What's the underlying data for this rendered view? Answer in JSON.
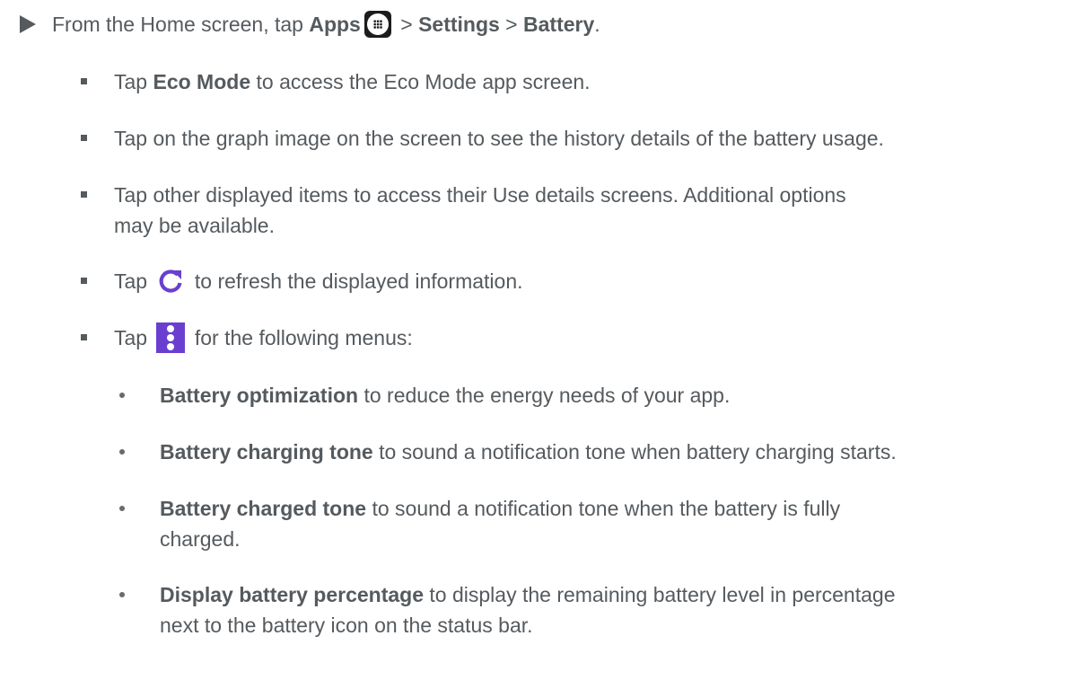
{
  "step": {
    "prefix": "From the Home screen, tap ",
    "apps": "Apps",
    "sep1": " > ",
    "settings": "Settings",
    "sep2": " > ",
    "battery": "Battery",
    "suffix": "."
  },
  "bullets": [
    {
      "pre": "Tap ",
      "bold": "Eco Mode",
      "post": " to access the Eco Mode app screen."
    },
    {
      "text": "Tap on the graph image on the screen to see the history details of the battery usage."
    },
    {
      "line1": "Tap other displayed items to access their Use details screens. Additional options",
      "line2": "may be available."
    },
    {
      "pre": "Tap ",
      "post": " to refresh the displayed information.",
      "icon": "refresh-icon"
    },
    {
      "pre": "Tap ",
      "post": " for the following menus:",
      "icon": "more-vert-icon"
    }
  ],
  "menus": [
    {
      "bold": "Battery optimization",
      "text": " to reduce the energy needs of your app."
    },
    {
      "bold": "Battery charging tone",
      "text": " to sound a notification tone when battery charging starts."
    },
    {
      "bold": "Battery charged tone",
      "text": " to sound a notification tone when the battery is fully",
      "line2": "charged."
    },
    {
      "bold": "Display battery percentage",
      "text": " to display the remaining battery level in percentage",
      "line2": "next to the battery icon on the status bar."
    }
  ],
  "colors": {
    "text": "#555a5e",
    "refresh_icon": "#6a3fd0",
    "menu_icon": "#6a3fd0",
    "apps_icon": "#1c1c1c"
  }
}
